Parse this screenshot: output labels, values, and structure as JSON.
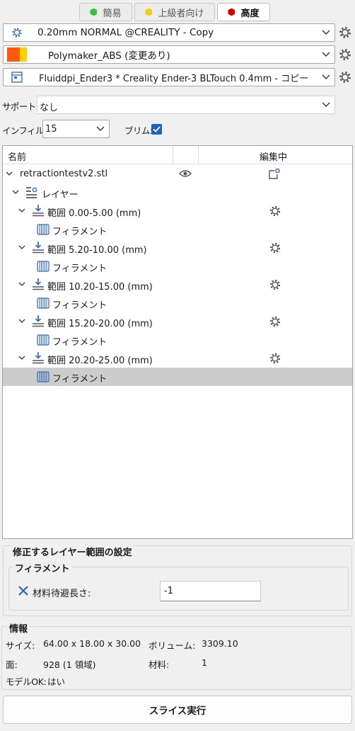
{
  "mode_buttons": [
    {
      "label": "簡易",
      "color": "#3cbf3c"
    },
    {
      "label": "上級者向け",
      "color": "#f2d00a"
    },
    {
      "label": "高度",
      "color": "#d40000"
    }
  ],
  "presets": {
    "print": "0.20mm NORMAL @CREALITY - Copy",
    "filament": "Polymaker_ABS (変更あり)",
    "printer": "Fluiddpi_Ender3 * Creality Ender-3 BLTouch 0.4mm - コピー",
    "filament_colors": [
      "#ff5a0a",
      "#ffd000"
    ]
  },
  "support": {
    "label": "サポート:",
    "value": "なし"
  },
  "infill": {
    "label": "インフィル:",
    "value": "15"
  },
  "brim": {
    "label": "ブリム:",
    "checked": true
  },
  "tree": {
    "col_name": "名前",
    "col_editing": "編集中",
    "object": "retractiontestv2.stl",
    "layers": "レイヤー",
    "ranges": [
      {
        "label": "範囲 0.00-5.00 (mm)",
        "child": "フィラメント"
      },
      {
        "label": "範囲 5.20-10.00 (mm)",
        "child": "フィラメント"
      },
      {
        "label": "範囲 10.20-15.00 (mm)",
        "child": "フィラメント"
      },
      {
        "label": "範囲 15.20-20.00 (mm)",
        "child": "フィラメント"
      },
      {
        "label": "範囲 20.20-25.00 (mm)",
        "child": "フィラメント"
      }
    ]
  },
  "layer_settings": {
    "title": "修正するレイヤー範囲の設定",
    "group": "フィラメント",
    "param_label": "材料待避長さ:",
    "param_value": "-1"
  },
  "info": {
    "title": "情報",
    "size_label": "サイズ:",
    "size_value": "64.00 x 18.00 x 30.00",
    "volume_label": "ボリューム:",
    "volume_value": "3309.10",
    "faces_label": "面:",
    "faces_value": "928 (1 領域)",
    "material_label": "材料:",
    "material_value": "1",
    "model_ok_label": "モデルOK:",
    "model_ok_value": "はい"
  },
  "slice_button": "スライス実行"
}
